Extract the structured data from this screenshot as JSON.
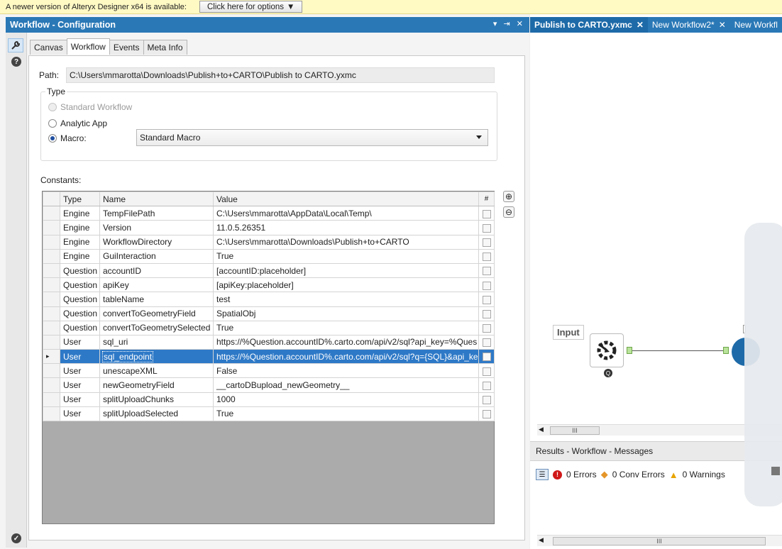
{
  "notification": {
    "text": "A newer version of Alteryx Designer x64 is available:",
    "button": "Click here for options"
  },
  "config_pane": {
    "title": "Workflow - Configuration",
    "controls": "▾ ⇥ ✕",
    "tabs": [
      "Canvas",
      "Workflow",
      "Events",
      "Meta Info"
    ],
    "active_tab": "Workflow",
    "path_label": "Path:",
    "path_value": "C:\\Users\\mmarotta\\Downloads\\Publish+to+CARTO\\Publish to CARTO.yxmc",
    "type_legend": "Type",
    "type_options": [
      "Standard Workflow",
      "Analytic App",
      "Macro:"
    ],
    "selected_type": "Macro:",
    "macro_select": "Standard Macro",
    "constants_label": "Constants:",
    "table": {
      "headers": [
        "Type",
        "Name",
        "Value",
        "#"
      ],
      "rows": [
        {
          "type": "Engine",
          "name": "TempFilePath",
          "value": "C:\\Users\\mmarotta\\AppData\\Local\\Temp\\"
        },
        {
          "type": "Engine",
          "name": "Version",
          "value": "11.0.5.26351"
        },
        {
          "type": "Engine",
          "name": "WorkflowDirectory",
          "value": "C:\\Users\\mmarotta\\Downloads\\Publish+to+CARTO"
        },
        {
          "type": "Engine",
          "name": "GuiInteraction",
          "value": "True"
        },
        {
          "type": "Question",
          "name": "accountID",
          "value": "[accountID:placeholder]"
        },
        {
          "type": "Question",
          "name": "apiKey",
          "value": "[apiKey:placeholder]"
        },
        {
          "type": "Question",
          "name": "tableName",
          "value": "test"
        },
        {
          "type": "Question",
          "name": "convertToGeometryField",
          "value": "SpatialObj"
        },
        {
          "type": "Question",
          "name": "convertToGeometrySelected",
          "value": "True"
        },
        {
          "type": "User",
          "name": "sql_uri",
          "value": "https://%Question.accountID%.carto.com/api/v2/sql?api_key=%Ques"
        },
        {
          "type": "User",
          "name": "sql_endpoint",
          "value": "https://%Question.accountID%.carto.com/api/v2/sql?q={SQL}&api_ke"
        },
        {
          "type": "User",
          "name": "unescapeXML",
          "value": "False"
        },
        {
          "type": "User",
          "name": "newGeometryField",
          "value": "__cartoDBupload_newGeometry__"
        },
        {
          "type": "User",
          "name": "splitUploadChunks",
          "value": "1000"
        },
        {
          "type": "User",
          "name": "splitUploadSelected",
          "value": "True"
        }
      ],
      "selected_row_name": "sql_endpoint"
    }
  },
  "doc_tabs": [
    {
      "label": "Publish to CARTO.yxmc",
      "active": true
    },
    {
      "label": "New Workflow2*",
      "active": false
    },
    {
      "label": "New Workfl",
      "active": false
    }
  ],
  "canvas": {
    "input_label": "Input"
  },
  "results": {
    "title": "Results - Workflow - Messages",
    "errors": "0 Errors",
    "conv_errors": "0 Conv Errors",
    "warnings": "0 Warnings"
  },
  "colors": {
    "accent": "#2a78b6",
    "selection": "#2e79c7",
    "notification_bg": "#fff9c4"
  }
}
